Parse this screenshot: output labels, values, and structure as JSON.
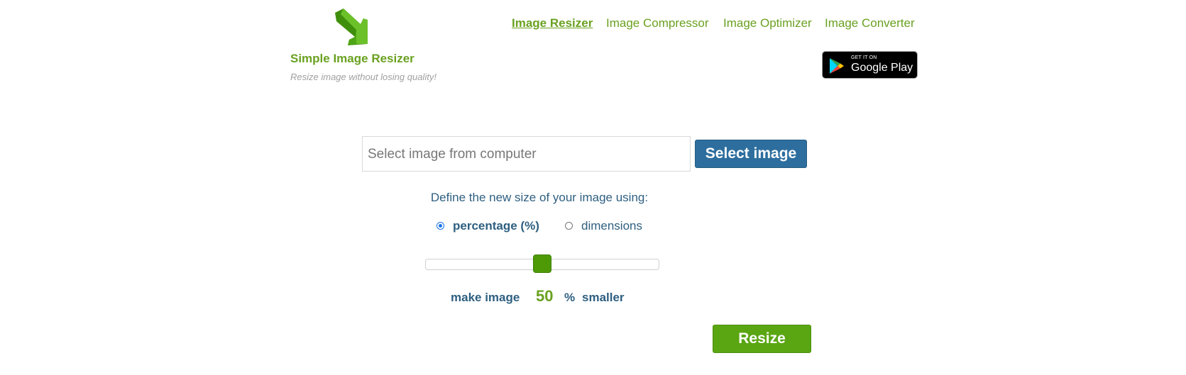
{
  "brand": {
    "title": "Simple Image Resizer",
    "tagline": "Resize image without losing quality!",
    "logo_icon": "download-arrow-icon",
    "color": "#6aa121"
  },
  "nav": {
    "items": [
      {
        "label": "Image Resizer",
        "active": true
      },
      {
        "label": "Image Compressor",
        "active": false
      },
      {
        "label": "Image Optimizer",
        "active": false
      },
      {
        "label": "Image Converter",
        "active": false
      }
    ]
  },
  "google_play": {
    "small_text": "GET IT ON",
    "big_text": "Google Play",
    "icon": "play-store-icon"
  },
  "file_select": {
    "placeholder": "Select image from computer",
    "button_label": "Select image",
    "button_color": "#2d6e9e"
  },
  "mode": {
    "prompt": "Define the new size of your image using:",
    "options": [
      {
        "label": "percentage (%)",
        "checked": true
      },
      {
        "label": "dimensions",
        "checked": false
      }
    ]
  },
  "slider": {
    "value_fraction": 0.5
  },
  "result": {
    "prefix": "make image",
    "value": "50",
    "unit": "%",
    "suffix": "smaller"
  },
  "actions": {
    "resize_label": "Resize",
    "resize_color": "#5aa612"
  }
}
